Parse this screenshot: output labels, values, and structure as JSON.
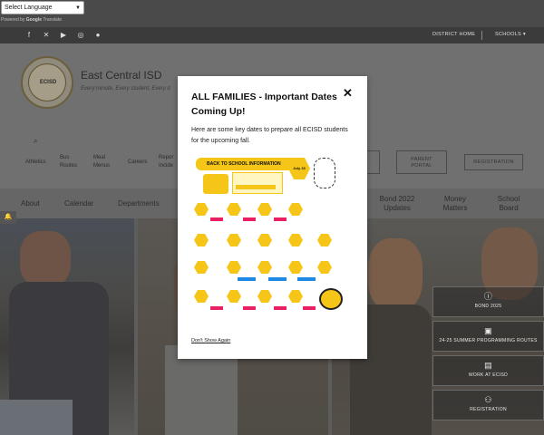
{
  "translate": {
    "select_label": "Select Language",
    "powered_by": "Powered by",
    "google": "Google",
    "translate": "Translate"
  },
  "top_bar": {
    "social_icons": [
      "facebook-icon",
      "x-icon",
      "youtube-icon",
      "instagram-icon",
      "flickr-icon"
    ],
    "district_home": "DISTRICT HOME",
    "schools": "SCHOOLS"
  },
  "header": {
    "logo_text": "ECISD",
    "site_name": "East Central ISD",
    "tagline": "Every minute, Every student, Every d"
  },
  "quick_links": [
    {
      "label": "Athletics"
    },
    {
      "label": "Bus\nRoutes"
    },
    {
      "label": "Meal\nMenus"
    },
    {
      "label": "Careers"
    },
    {
      "label": "Repor\nIncide"
    }
  ],
  "header_buttons": {
    "parent_portal": "PARENT\nPORTAL",
    "registration": "REGISTRATION"
  },
  "main_nav": [
    {
      "label": "About"
    },
    {
      "label": "Calendar"
    },
    {
      "label": "Departments"
    },
    {
      "label": "Bond 2022\nUpdates"
    },
    {
      "label": "Money\nMatters"
    },
    {
      "label": "School\nBoard"
    }
  ],
  "side_buttons": [
    {
      "icon": "info-icon",
      "label": "BOND 2025"
    },
    {
      "icon": "bus-icon",
      "label": "24-25 SUMMER PROGRAMMING ROUTES"
    },
    {
      "icon": "briefcase-icon",
      "label": "WORK AT ECISD"
    },
    {
      "icon": "user-add-icon",
      "label": "REGISTRATION"
    }
  ],
  "modal": {
    "title": "ALL FAMILIES - Important Dates Coming Up!",
    "body": "Here are some key dates to prepare all ECISD students for the upcoming fall.",
    "dont_show": "Don't Show Again",
    "flyer_heading": "BACK TO SCHOOL INFORMATION",
    "flyer_badge": "July 23"
  },
  "colors": {
    "overlay": "#6f6f6f",
    "accent_yellow": "#f5c518",
    "accent_pink": "#e91e63",
    "accent_blue": "#1e88e5"
  }
}
